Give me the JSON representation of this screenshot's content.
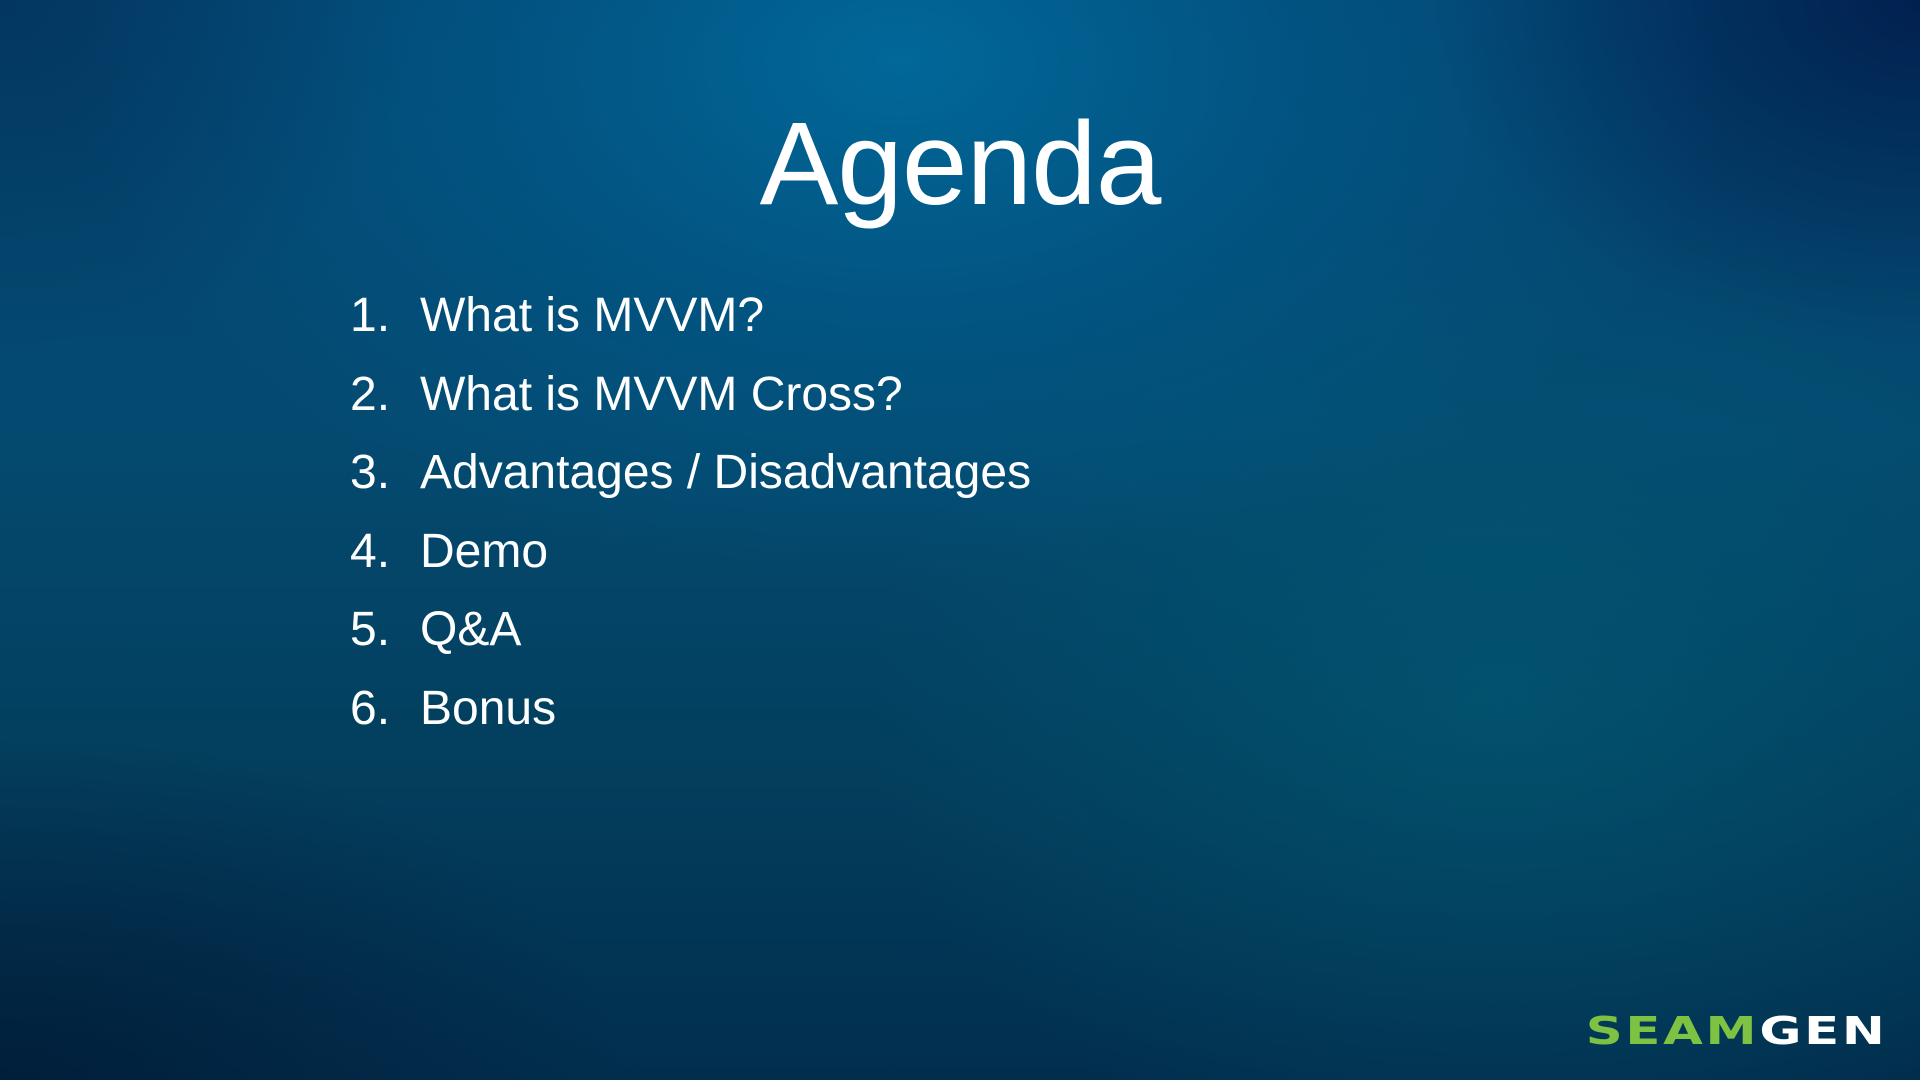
{
  "slide": {
    "title": "Agenda",
    "items": [
      {
        "number": "1.",
        "text": "What is MVVM?"
      },
      {
        "number": "2.",
        "text": "What is MVVM Cross?"
      },
      {
        "number": "3.",
        "text": "Advantages / Disadvantages"
      },
      {
        "number": "4.",
        "text": "Demo"
      },
      {
        "number": "5.",
        "text": "Q&A"
      },
      {
        "number": "6.",
        "text": "Bonus"
      }
    ]
  },
  "logo": {
    "part1": "SEAM",
    "part2": "GEN",
    "color_part1": "#7dc242",
    "color_part2": "#ffffff"
  }
}
